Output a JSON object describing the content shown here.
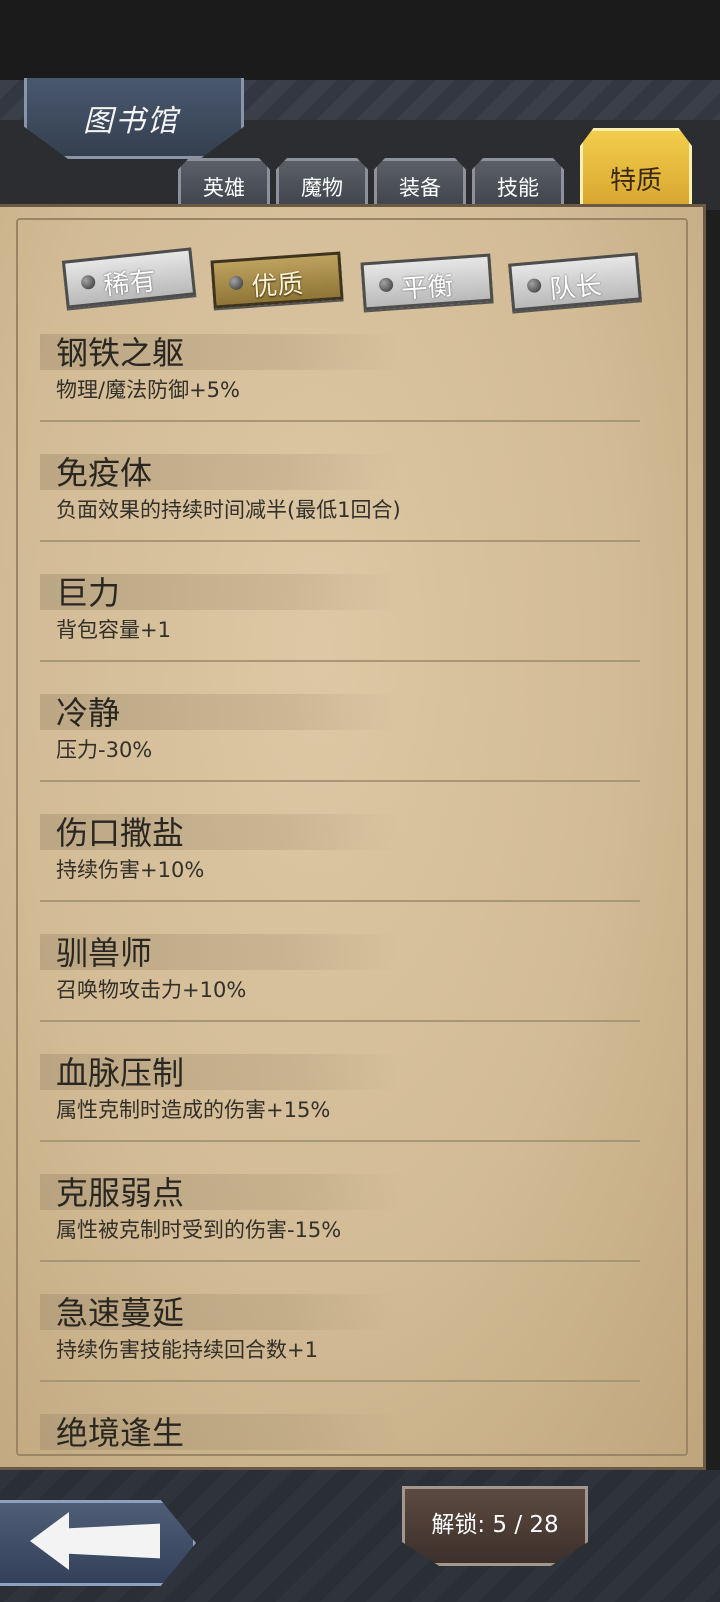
{
  "header": {
    "title": "图书馆"
  },
  "tabs": [
    {
      "label": "英雄",
      "active": false
    },
    {
      "label": "魔物",
      "active": false
    },
    {
      "label": "装备",
      "active": false
    },
    {
      "label": "技能",
      "active": false
    },
    {
      "label": "特质",
      "active": true
    }
  ],
  "subtabs": [
    {
      "label": "稀有",
      "active": false
    },
    {
      "label": "优质",
      "active": true
    },
    {
      "label": "平衡",
      "active": false
    },
    {
      "label": "队长",
      "active": false
    }
  ],
  "traits": [
    {
      "name": "钢铁之躯",
      "desc": "物理/魔法防御+5%"
    },
    {
      "name": "免疫体",
      "desc": "负面效果的持续时间减半(最低1回合)"
    },
    {
      "name": "巨力",
      "desc": "背包容量+1"
    },
    {
      "name": "冷静",
      "desc": "压力-30%"
    },
    {
      "name": "伤口撒盐",
      "desc": "持续伤害+10%"
    },
    {
      "name": "驯兽师",
      "desc": "召唤物攻击力+10%"
    },
    {
      "name": "血脉压制",
      "desc": "属性克制时造成的伤害+15%"
    },
    {
      "name": "克服弱点",
      "desc": "属性被克制时受到的伤害-15%"
    },
    {
      "name": "急速蔓延",
      "desc": "持续伤害技能持续回合数+1"
    },
    {
      "name": "绝境逢生",
      "desc": ""
    }
  ],
  "footer": {
    "unlock_text": "解锁: 5 / 28"
  },
  "icons": {
    "back": "back-arrow-icon",
    "subtab_marker": "rivet-icon"
  },
  "colors": {
    "active_tab": "#e9bf3f",
    "paper": "#d7c19b",
    "active_subtab": "#a88b49"
  }
}
